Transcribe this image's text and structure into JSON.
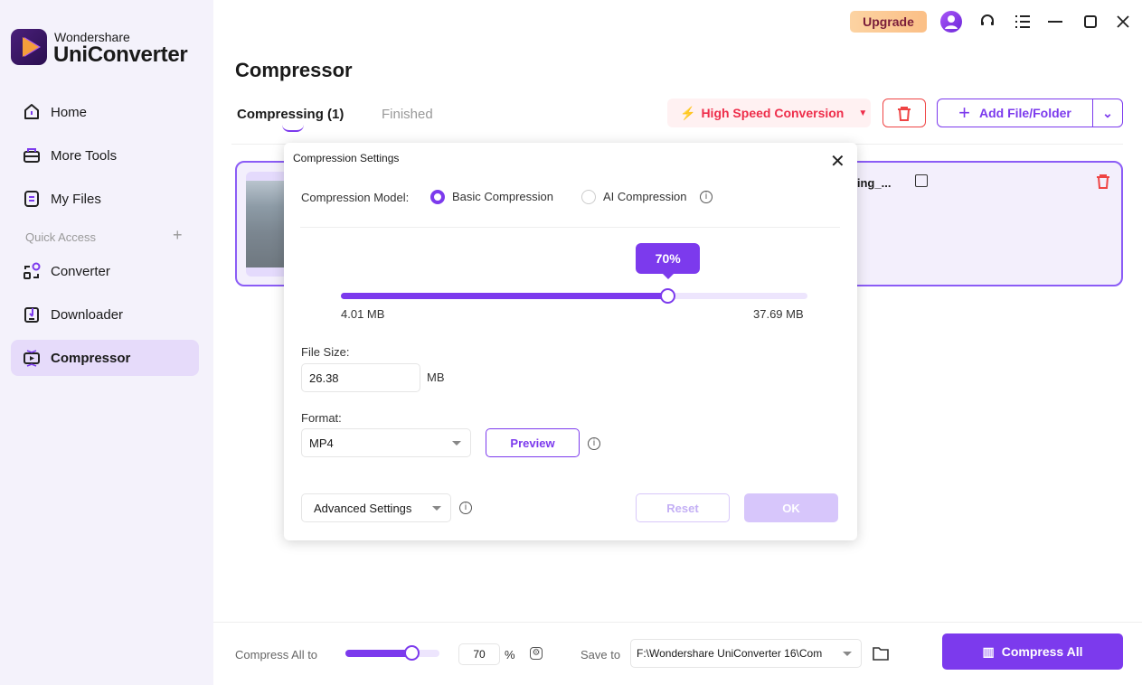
{
  "app": {
    "brand_line1": "Wondershare",
    "brand_line2": "UniConverter"
  },
  "sidebar": {
    "items": [
      {
        "label": "Home"
      },
      {
        "label": "More Tools"
      },
      {
        "label": "My Files"
      },
      {
        "label": "Converter"
      },
      {
        "label": "Downloader"
      },
      {
        "label": "Compressor",
        "active": true
      }
    ],
    "quick_access": "Quick Access"
  },
  "topbar": {
    "upgrade": "Upgrade"
  },
  "page": {
    "title": "Compressor",
    "tabs": [
      {
        "label": "Compressing (1)",
        "active": true
      },
      {
        "label": "Finished"
      }
    ]
  },
  "toolbar": {
    "high_speed": "High Speed Conversion",
    "add_file": "Add File/Folder"
  },
  "file": {
    "name_fragment": "ghing_..."
  },
  "dialog": {
    "title": "Compression Settings",
    "model_label": "Compression Model:",
    "basic": "Basic Compression",
    "ai": "AI Compression",
    "selected_model": "Basic Compression",
    "percent": 70,
    "percent_label": "70%",
    "min_size": "4.01 MB",
    "max_size": "37.69 MB",
    "file_size_label": "File Size:",
    "file_size": "26.38",
    "unit": "MB",
    "format_label": "Format:",
    "format": "MP4",
    "preview": "Preview",
    "advanced": "Advanced Settings",
    "reset": "Reset",
    "ok": "OK"
  },
  "bottom": {
    "compress_all_label": "Compress All to",
    "percent": 70,
    "percent_value": "70",
    "percent_sign": "%",
    "save_to_label": "Save to",
    "save_path": "F:\\Wondershare UniConverter 16\\Com",
    "compress_all": "Compress All"
  },
  "colors": {
    "accent": "#7c3aed",
    "danger": "#ef4444",
    "upgrade_bg": "#fcd3a2"
  }
}
